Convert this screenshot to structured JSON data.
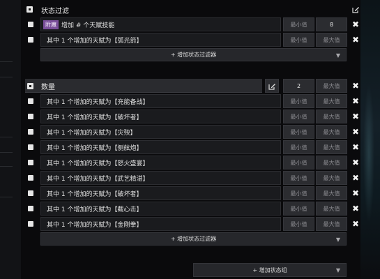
{
  "status_filter": {
    "title": "状态过滤",
    "rows": [
      {
        "tag": "附魔",
        "text": "增加 # 个天赋技能",
        "min": "最小值",
        "max": "8"
      },
      {
        "tag": "",
        "text": "其中 1 个增加的天赋为【弧光箭】",
        "min": "最小值",
        "max": "最大值"
      }
    ],
    "add_filter_label": "+ 增加状态过滤器"
  },
  "count_group": {
    "title": "数量",
    "count_value": "2",
    "max_label": "最大值",
    "rows": [
      {
        "text": "其中 1 个增加的天赋为【充能备战】",
        "min": "最小值",
        "max": "最大值"
      },
      {
        "text": "其中 1 个增加的天赋为【破坏者】",
        "min": "最小值",
        "max": "最大值"
      },
      {
        "text": "其中 1 个增加的天赋为【灾殃】",
        "min": "最小值",
        "max": "最大值"
      },
      {
        "text": "其中 1 个增加的天赋为【侧舷炮】",
        "min": "最小值",
        "max": "最大值"
      },
      {
        "text": "其中 1 个增加的天赋为【怒火盛宴】",
        "min": "最小值",
        "max": "最大值"
      },
      {
        "text": "其中 1 个增加的天赋为【武艺精湛】",
        "min": "最小值",
        "max": "最大值"
      },
      {
        "text": "其中 1 个增加的天赋为【破坏者】",
        "min": "最小值",
        "max": "最大值"
      },
      {
        "text": "其中 1 个增加的天赋为【截心击】",
        "min": "最小值",
        "max": "最大值"
      },
      {
        "text": "其中 1 个增加的天赋为【金刚拳】",
        "min": "最小值",
        "max": "最大值"
      }
    ],
    "add_filter_label": "+ 增加状态过滤器"
  },
  "add_group_label": "+ 增加状态组",
  "icons": {
    "edit": "edit-icon",
    "delete": "close-icon",
    "chevron": "chevron-down-icon"
  },
  "colors": {
    "tag_bg": "#7a4f9a",
    "panel_bg": "#1a1b1e",
    "button_bg": "#2b2c30"
  }
}
